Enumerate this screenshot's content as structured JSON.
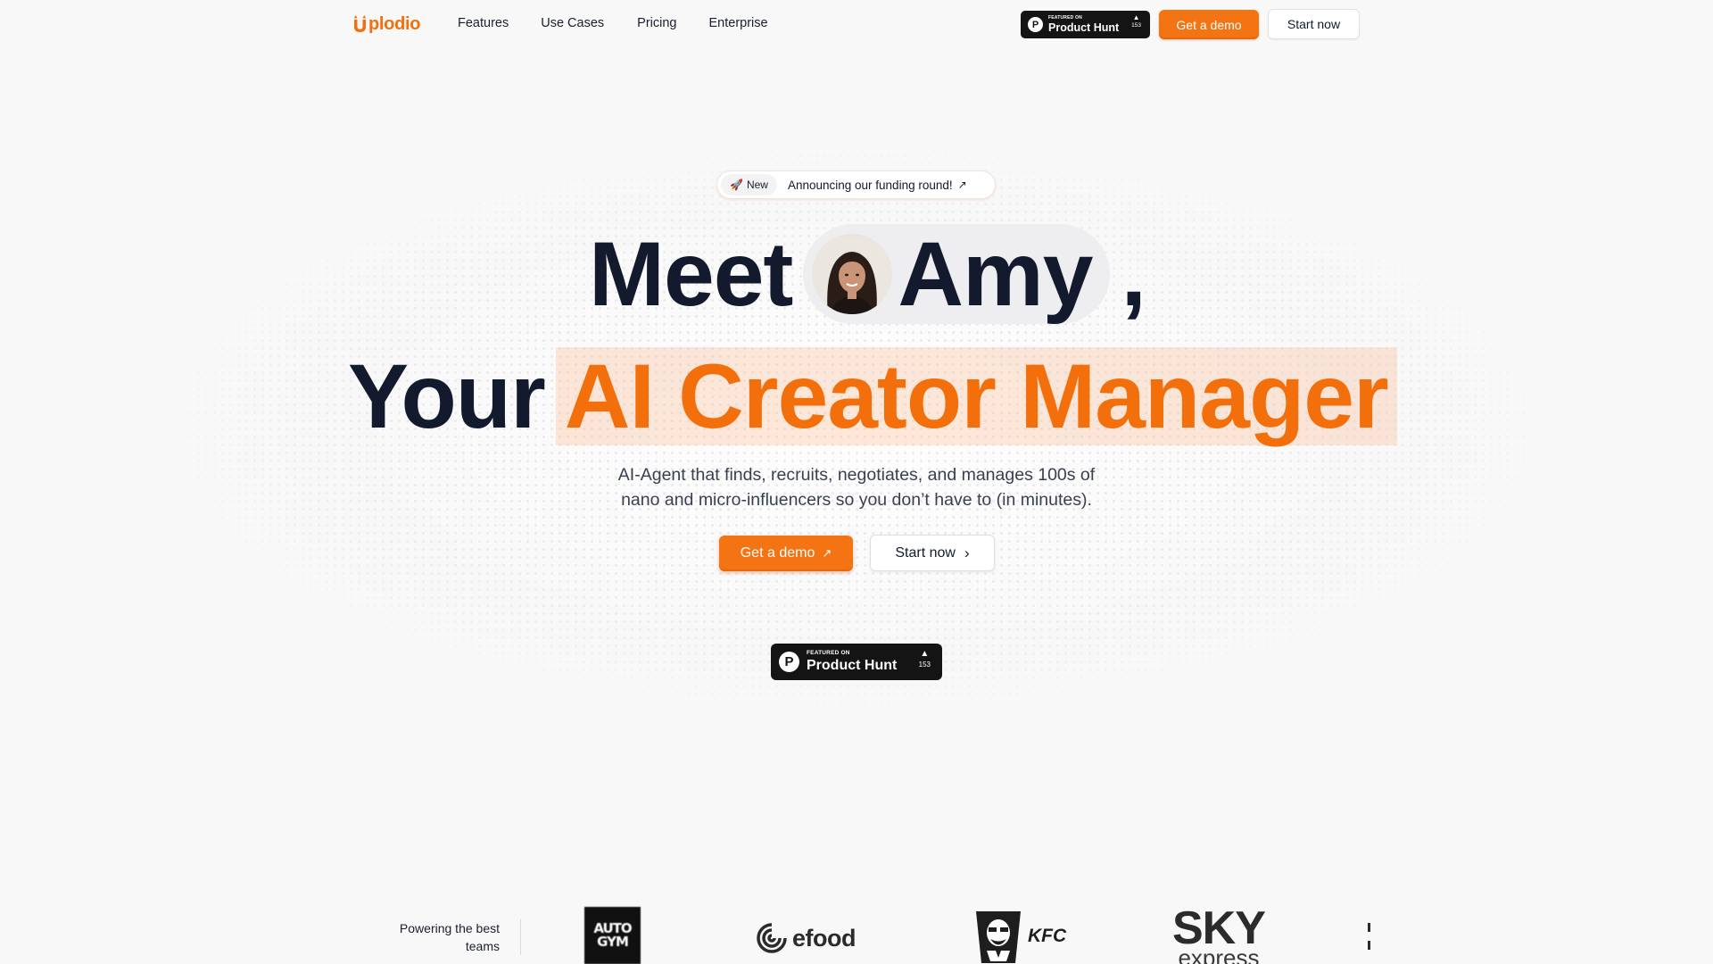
{
  "brand": {
    "name": "Uplodio",
    "logo_rest": "plodio",
    "accent": "#f36f0c"
  },
  "nav": {
    "links": [
      "Features",
      "Use Cases",
      "Pricing",
      "Enterprise"
    ],
    "product_hunt": {
      "featured": "FEATURED ON",
      "name": "Product Hunt",
      "votes": "153"
    },
    "demo_label": "Get a demo",
    "start_label": "Start now"
  },
  "announcement": {
    "tag": "New",
    "text": "Announcing our funding round!"
  },
  "hero": {
    "line1_pre": "Meet",
    "line1_name": "Amy",
    "line1_post": ",",
    "line2_pre": "Your",
    "line2_highlight": "AI Creator Manager",
    "subtitle_line1": "AI-Agent that finds, recruits, negotiates, and manages 100s of",
    "subtitle_line2": "nano and micro-influencers so you don’t have to (in minutes).",
    "demo_label": "Get a demo",
    "start_label": "Start now"
  },
  "product_hunt_large": {
    "featured": "FEATURED ON",
    "name": "Product Hunt",
    "votes": "153"
  },
  "logos": {
    "caption_line1": "Powering the best",
    "caption_line2": "teams",
    "autogym_line1": "AUTO",
    "autogym_line2": "GYM",
    "efood": "efood",
    "kfc": "KFC",
    "sky_line1": "SKY",
    "sky_line2": "express"
  },
  "colors": {
    "orange": "#f47413",
    "dark": "#141a2e",
    "background": "#f8f8f9"
  }
}
